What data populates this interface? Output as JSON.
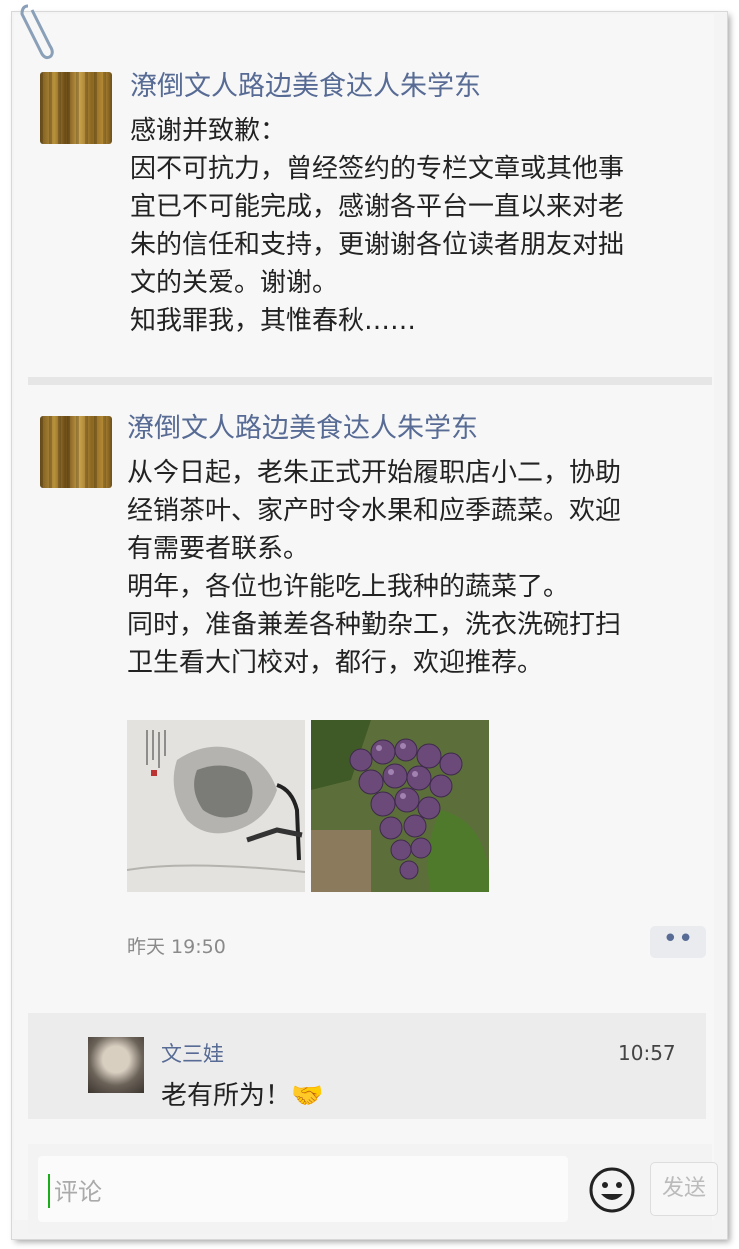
{
  "posts": [
    {
      "author": "潦倒文人路边美食达人朱学东",
      "lines": [
        "感谢并致歉：",
        "因不可抗力，曾经签约的专栏文章或其他事",
        "宜已不可能完成，感谢各平台一直以来对老",
        "朱的信任和支持，更谢谢各位读者朋友对拙",
        "文的关爱。谢谢。",
        "知我罪我，其惟春秋……"
      ]
    },
    {
      "author": "潦倒文人路边美食达人朱学东",
      "lines": [
        "从今日起，老朱正式开始履职店小二，协助",
        "经销茶叶、家产时令水果和应季蔬菜。欢迎",
        "有需要者联系。",
        "明年，各位也许能吃上我种的蔬菜了。",
        "同时，准备兼差各种勤杂工，洗衣洗碗打扫",
        "卫生看大门校对，都行，欢迎推荐。"
      ],
      "time": "昨天 19:50",
      "more_label": "••"
    }
  ],
  "comment": {
    "author": "文三娃",
    "time": "10:57",
    "text": "老有所为！",
    "emoji": "🤝"
  },
  "input": {
    "placeholder": "评论",
    "send_label": "发送"
  },
  "colors": {
    "link": "#576b95",
    "text": "#222222",
    "caret": "#1aad19"
  }
}
